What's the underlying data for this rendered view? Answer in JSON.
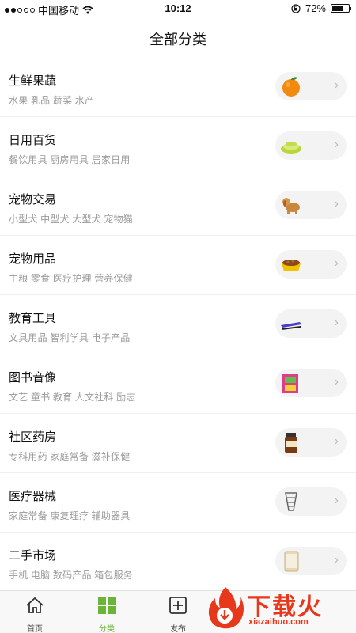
{
  "status": {
    "carrier": "中国移动",
    "time": "10:12",
    "battery": "72%",
    "battery_level": 0.72,
    "signal_icon": "signal-dots-icon",
    "wifi_icon": "wifi-icon",
    "lock_icon": "orientation-lock-icon"
  },
  "header": {
    "title": "全部分类"
  },
  "categories": [
    {
      "title": "生鲜果蔬",
      "sub": "水果 乳品 蔬菜 水产",
      "icon": "orange-icon"
    },
    {
      "title": "日用百货",
      "sub": "餐饮用具 厨房用具 居家日用",
      "icon": "plates-icon"
    },
    {
      "title": "宠物交易",
      "sub": "小型犬 中型犬 大型犬 宠物猫",
      "icon": "dog-icon"
    },
    {
      "title": "宠物用品",
      "sub": "主粮 零食 医疗护理 营养保健",
      "icon": "pet-bowl-icon"
    },
    {
      "title": "教育工具",
      "sub": "文具用品 智利学具 电子产品",
      "icon": "stapler-icon"
    },
    {
      "title": "图书音像",
      "sub": "文艺 童书 教育 人文社科 励志",
      "icon": "books-icon"
    },
    {
      "title": "社区药房",
      "sub": "专科用药 家庭常备 滋补保健",
      "icon": "medicine-bottle-icon"
    },
    {
      "title": "医疗器械",
      "sub": "家庭常备 康复理疗 辅助器具",
      "icon": "medical-device-icon"
    },
    {
      "title": "二手市场",
      "sub": "手机 电脑 数码产品 箱包服务",
      "icon": "tablet-icon"
    }
  ],
  "tabbar": {
    "home": {
      "label": "首页",
      "icon": "home-icon"
    },
    "category": {
      "label": "分类",
      "icon": "grid-icon"
    },
    "publish": {
      "label": "发布",
      "icon": "plus-square-icon"
    }
  },
  "watermark": {
    "text": "下载火",
    "url": "xiazaihuo.com"
  },
  "colors": {
    "accent": "#6ab437",
    "watermark": "#e8381c"
  }
}
